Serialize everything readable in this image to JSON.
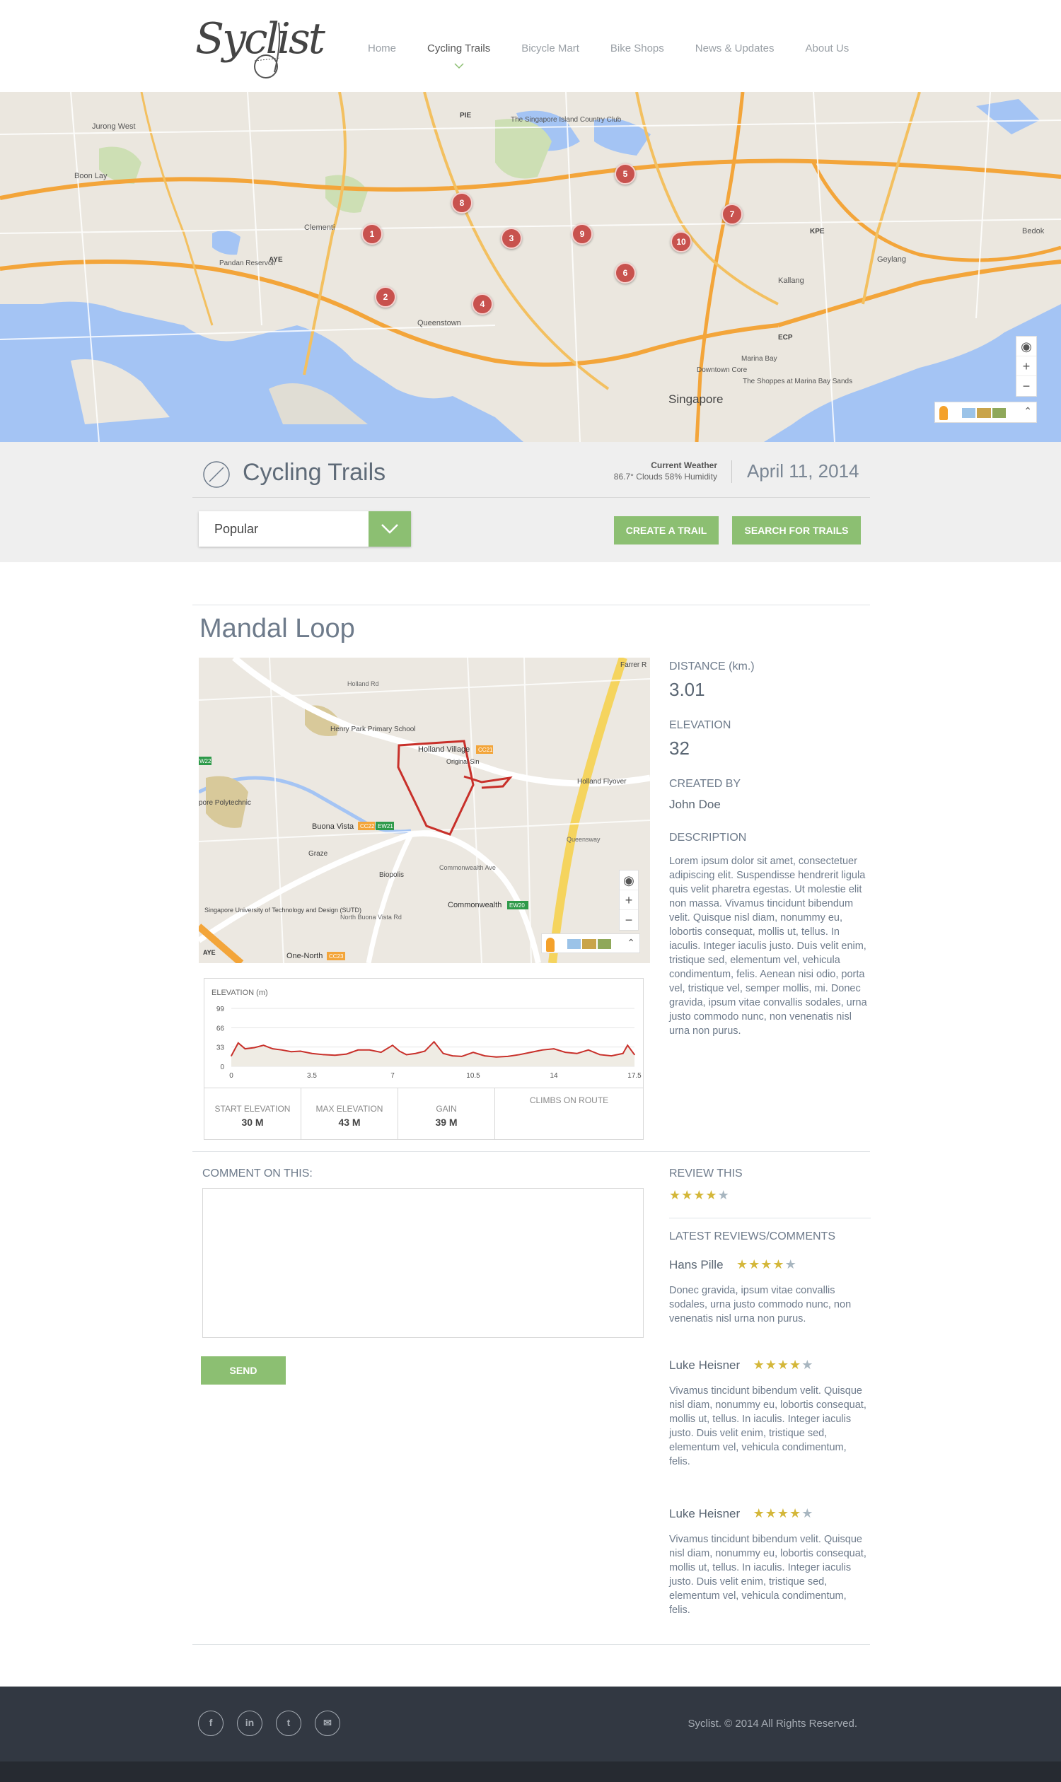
{
  "header": {
    "logo_text": "Syclist",
    "nav": [
      "Home",
      "Cycling Trails",
      "Bicycle Mart",
      "Bike Shops",
      "News & Updates",
      "About Us"
    ],
    "active_nav": "Cycling Trails"
  },
  "map": {
    "labels": {
      "jurong_west": "Jurong West",
      "boon_lay": "Boon Lay",
      "pandan": "Pandan Reservoir",
      "clementi": "Clementi",
      "queenstown": "Queenstown",
      "singapore": "Singapore",
      "marina_bay": "Marina Bay",
      "shoppes": "The Shoppes at Marina Bay Sands",
      "country_club": "The Singapore Island Country Club",
      "geylang": "Geylang",
      "bedok": "Bedok",
      "kallang": "Kallang",
      "downtown": "Downtown Core",
      "aye": "AYE",
      "pie": "PIE",
      "ecp": "ECP",
      "kpe": "KPE"
    },
    "markers": [
      "1",
      "2",
      "3",
      "4",
      "5",
      "6",
      "7",
      "8",
      "9",
      "10"
    ],
    "controls": {
      "locate": "◉",
      "zoom_in": "+",
      "zoom_out": "−",
      "expand": "⌃"
    }
  },
  "band": {
    "title": "Cycling Trails",
    "weather_label": "Current Weather",
    "weather_info": "86.7° Clouds 58% Humidity",
    "date": "April 11, 2014",
    "select_value": "Popular",
    "create_btn": "CREATE A TRAIL",
    "search_btn": "SEARCH FOR TRAILS"
  },
  "trail": {
    "title": "Mandal Loop",
    "map_labels": {
      "holland_village": "Holland Village",
      "henry_park": "Henry Park Primary School",
      "buona_vista": "Buona Vista",
      "commonwealth": "Commonwealth",
      "one_north": "One-North",
      "sutd": "Singapore University of Technology and Design (SUTD)",
      "biopolis": "Biopolis",
      "polytechnic": "pore Polytechnic",
      "holland_flyover": "Holland Flyover",
      "farrer": "Farrer R",
      "graze": "Graze",
      "original_sin": "Original Sin",
      "queensway": "Queensway",
      "commonwealth_ave": "Commonwealth Ave",
      "holland_rd": "Holland Rd",
      "north_buona": "North Buona Vista Rd",
      "cc21": "CC21",
      "cc22": "CC22",
      "ew21": "EW21",
      "ew20": "EW20",
      "cc23": "CC23",
      "ew22": "W22",
      "aye": "AYE"
    },
    "stats": {
      "distance_label": "DISTANCE (km.)",
      "distance_value": "3.01",
      "elevation_label": "ELEVATION",
      "elevation_value": "32",
      "created_label": "CREATED BY",
      "created_value": "John Doe",
      "description_label": "DESCRIPTION",
      "description": "Lorem ipsum dolor sit amet, consectetuer adipiscing elit. Suspendisse hendrerit ligula quis velit pharetra egestas. Ut molestie elit non massa. Vivamus tincidunt bibendum velit. Quisque nisl diam, nonummy eu, lobortis consequat, mollis ut, tellus. In iaculis. Integer iaculis justo. Duis velit enim, tristique sed, elementum vel, vehicula condimentum, felis. Aenean nisi odio, porta vel, tristique vel, semper mollis, mi. Donec gravida, ipsum vitae convallis sodales, urna justo commodo nunc, non venenatis nisl urna non purus."
    }
  },
  "elevation": {
    "title": "ELEVATION (m)",
    "start_label": "START ELEVATION",
    "start_value": "30 M",
    "max_label": "MAX ELEVATION",
    "max_value": "43 M",
    "gain_label": "GAIN",
    "gain_value": "39 M",
    "climbs_label": "CLIMBS ON ROUTE"
  },
  "chart_data": {
    "type": "area",
    "title": "ELEVATION (m)",
    "x_ticks": [
      "0",
      "3.5",
      "7",
      "10.5",
      "14",
      "17.5"
    ],
    "y_ticks": [
      "0",
      "33",
      "66",
      "99"
    ],
    "ylim": [
      0,
      99
    ],
    "xlim": [
      0,
      17.5
    ],
    "x": [
      0,
      0.3,
      0.6,
      1.0,
      1.4,
      1.8,
      2.2,
      2.6,
      3.0,
      3.5,
      4.0,
      4.5,
      5.0,
      5.5,
      6.0,
      6.5,
      7.0,
      7.3,
      7.6,
      8.0,
      8.4,
      8.8,
      9.2,
      9.6,
      10.0,
      10.5,
      11.0,
      11.5,
      12.0,
      12.5,
      13.0,
      13.5,
      14.0,
      14.5,
      15.0,
      15.5,
      16.0,
      16.5,
      17.0,
      17.2,
      17.5
    ],
    "values": [
      18,
      40,
      30,
      32,
      36,
      30,
      28,
      25,
      26,
      22,
      20,
      19,
      21,
      28,
      28,
      24,
      36,
      26,
      20,
      22,
      26,
      42,
      22,
      18,
      17,
      24,
      18,
      16,
      17,
      20,
      24,
      28,
      30,
      24,
      22,
      28,
      20,
      18,
      22,
      36,
      20
    ],
    "grid": true,
    "colors": {
      "line": "#c8302a",
      "fill": "#efece4"
    }
  },
  "comments": {
    "comment_label": "COMMENT ON THIS:",
    "comment_placeholder": "",
    "send_label": "SEND",
    "review_label": "REVIEW THIS",
    "latest_label": "LATEST REVIEWS/COMMENTS",
    "review_rating": 4,
    "reviews": [
      {
        "name": "Hans Pille",
        "rating": 4,
        "text": "Donec gravida, ipsum vitae convallis sodales, urna justo commodo nunc, non venenatis nisl urna non purus."
      },
      {
        "name": "Luke Heisner",
        "rating": 4,
        "text": "Vivamus tincidunt bibendum velit. Quisque nisl diam, nonummy eu, lobortis consequat, mollis ut, tellus. In iaculis. Integer iaculis justo. Duis velit enim, tristique sed, elementum vel, vehicula condimentum, felis."
      },
      {
        "name": "Luke Heisner",
        "rating": 4,
        "text": "Vivamus tincidunt bibendum velit. Quisque nisl diam, nonummy eu, lobortis consequat, mollis ut, tellus. In iaculis. Integer iaculis justo. Duis velit enim, tristique sed, elementum vel, vehicula condimentum, felis."
      }
    ]
  },
  "footer": {
    "social": [
      {
        "name": "facebook-icon",
        "glyph": "f"
      },
      {
        "name": "linkedin-icon",
        "glyph": "in"
      },
      {
        "name": "twitter-icon",
        "glyph": "t"
      },
      {
        "name": "email-icon",
        "glyph": "✉"
      }
    ],
    "copyright": "Syclist. © 2014 All Rights Reserved."
  },
  "colors": {
    "accent": "#8cbf72",
    "marker": "#c8524e",
    "star_on": "#d4b73a",
    "star_off": "#a8b6c0",
    "footer": "#323842"
  }
}
